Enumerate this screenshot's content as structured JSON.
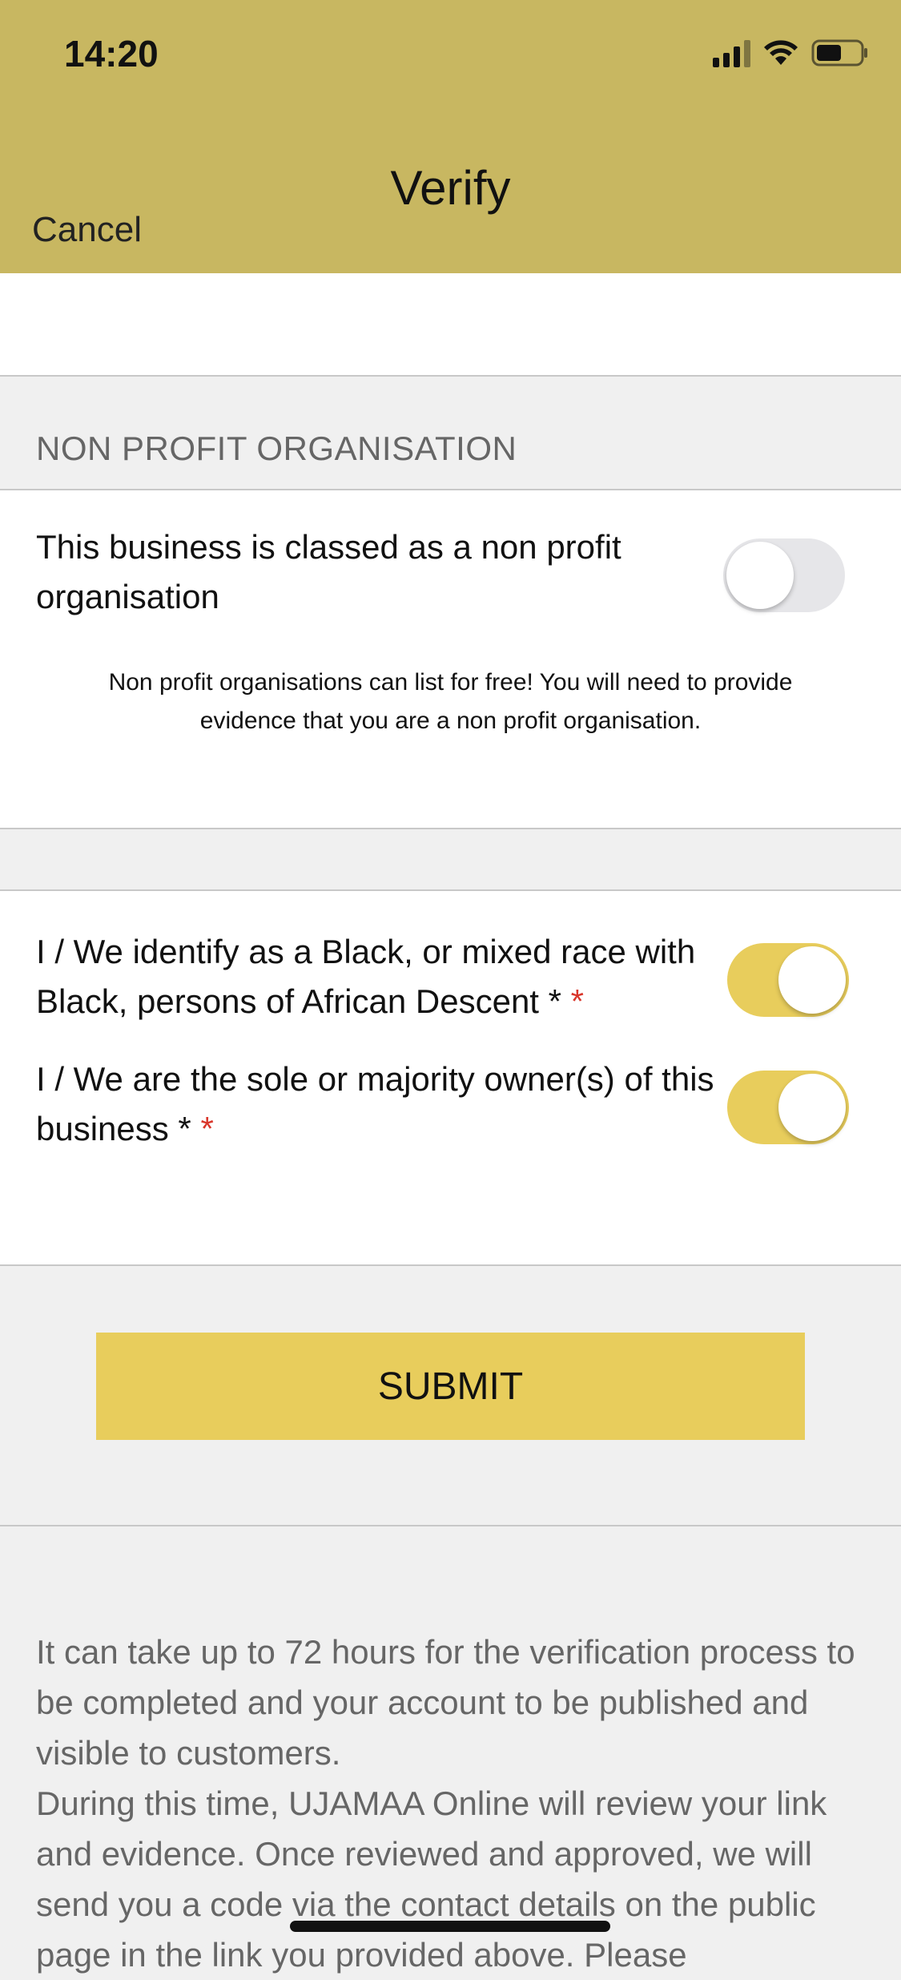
{
  "status_bar": {
    "time": "14:20"
  },
  "nav": {
    "title": "Verify",
    "cancel_label": "Cancel"
  },
  "non_profit": {
    "section_title": "NON PROFIT ORGANISATION",
    "toggle_label": "This business is classed as a non profit organisation",
    "toggle_on": false,
    "note": "Non profit organisations can list for free! You will need to provide evidence that you are a non profit organisation."
  },
  "declarations": [
    {
      "label": "I / We identify as a Black, or mixed race with Black, persons of African Descent *",
      "required_mark": "*",
      "toggle_on": true
    },
    {
      "label": "I / We are the sole or majority owner(s) of this business *",
      "required_mark": "*",
      "toggle_on": true
    }
  ],
  "submit_label": "SUBMIT",
  "info": {
    "paragraph1": "It can take up to 72 hours for the verification process to be completed and your account to be published and visible to customers.",
    "paragraph2": "During this time, UJAMAA Online will review your link and evidence. Once reviewed and approved, we will send you a code via the contact details on the public page in the link you provided above. Please"
  },
  "colors": {
    "header_bg": "#c8b761",
    "accent": "#e8cd5c",
    "required": "#d9362b"
  }
}
